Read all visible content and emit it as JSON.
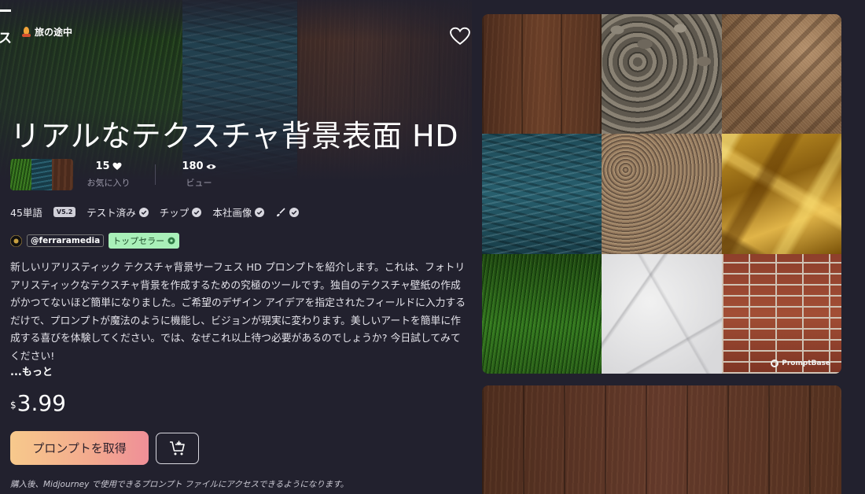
{
  "header": {
    "corner_glyph": "ス",
    "travel_badge": "旅の途中"
  },
  "product": {
    "title": "リアルなテクスチャ背景表面 HD",
    "stats": {
      "favorites_value": "15",
      "favorites_label": "お気に入り",
      "views_value": "180",
      "views_label": "ビュー"
    },
    "meta": {
      "word_count": "45単語",
      "version": "V5.2",
      "tested": "テスト済み",
      "tips": "チップ",
      "own_images": "本社画像"
    },
    "author": {
      "handle": "@ferraramedia",
      "badge": "トップセラー"
    },
    "description": "新しいリアリスティック テクスチャ背景サーフェス HD プロンプトを紹介します。これは、フォトリアリスティックなテクスチャ背景を作成するための究極のツールです。独自のテクスチャ壁紙の作成がかつてないほど簡単になりました。ご希望のデザイン アイデアを指定されたフィールドに入力するだけで、プロンプトが魔法のように機能し、ビジョンが現実に変わります。美しいアートを簡単に作成する喜びを体験してください。では、なぜこれ以上待つ必要があるのでしょうか? 今日試してみてください!",
    "more_label": "...もっと",
    "price_currency": "$",
    "price_amount": "3.99",
    "buy_label": "プロンプトを取得",
    "purchase_note": "購入後、Midjourney で使用できるプロンプト ファイルにアクセスできるようになります。"
  },
  "gallery": {
    "tiles": [
      "wood",
      "stone",
      "fabric",
      "water",
      "pebbles",
      "gold-foil",
      "grass",
      "marble",
      "brick"
    ],
    "watermark": "PromptBase"
  },
  "icons": {
    "favorite": "heart-outline-icon",
    "views": "eye-icon",
    "verified": "check-badge-icon",
    "cart": "add-to-cart-icon"
  },
  "colors": {
    "background": "#22212e",
    "seller_badge_bg": "#a9f0b9",
    "buy_gradient_start": "#f7c98c",
    "buy_gradient_end": "#ef8f98"
  }
}
